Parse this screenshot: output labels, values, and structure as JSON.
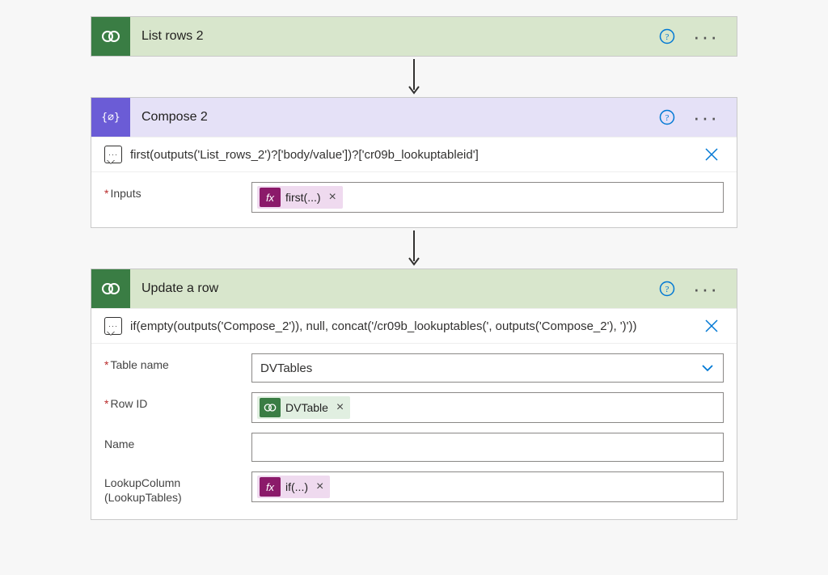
{
  "cards": {
    "listRows2": {
      "title": "List rows 2"
    },
    "compose2": {
      "title": "Compose 2",
      "comment": "first(outputs('List_rows_2')?['body/value'])?['cr09b_lookuptableid']",
      "fields": {
        "inputs": {
          "label": "Inputs",
          "pill": "first(...)"
        }
      }
    },
    "updateRow": {
      "title": "Update a row",
      "comment": "if(empty(outputs('Compose_2')), null, concat('/cr09b_lookuptables(', outputs('Compose_2'), ')'))",
      "fields": {
        "tableName": {
          "label": "Table name",
          "value": "DVTables"
        },
        "rowId": {
          "label": "Row ID",
          "pill": "DVTable"
        },
        "name": {
          "label": "Name"
        },
        "lookupColumn": {
          "label": "LookupColumn (LookupTables)",
          "pill": "if(...)"
        }
      }
    }
  },
  "icons": {
    "fx": "fx"
  }
}
